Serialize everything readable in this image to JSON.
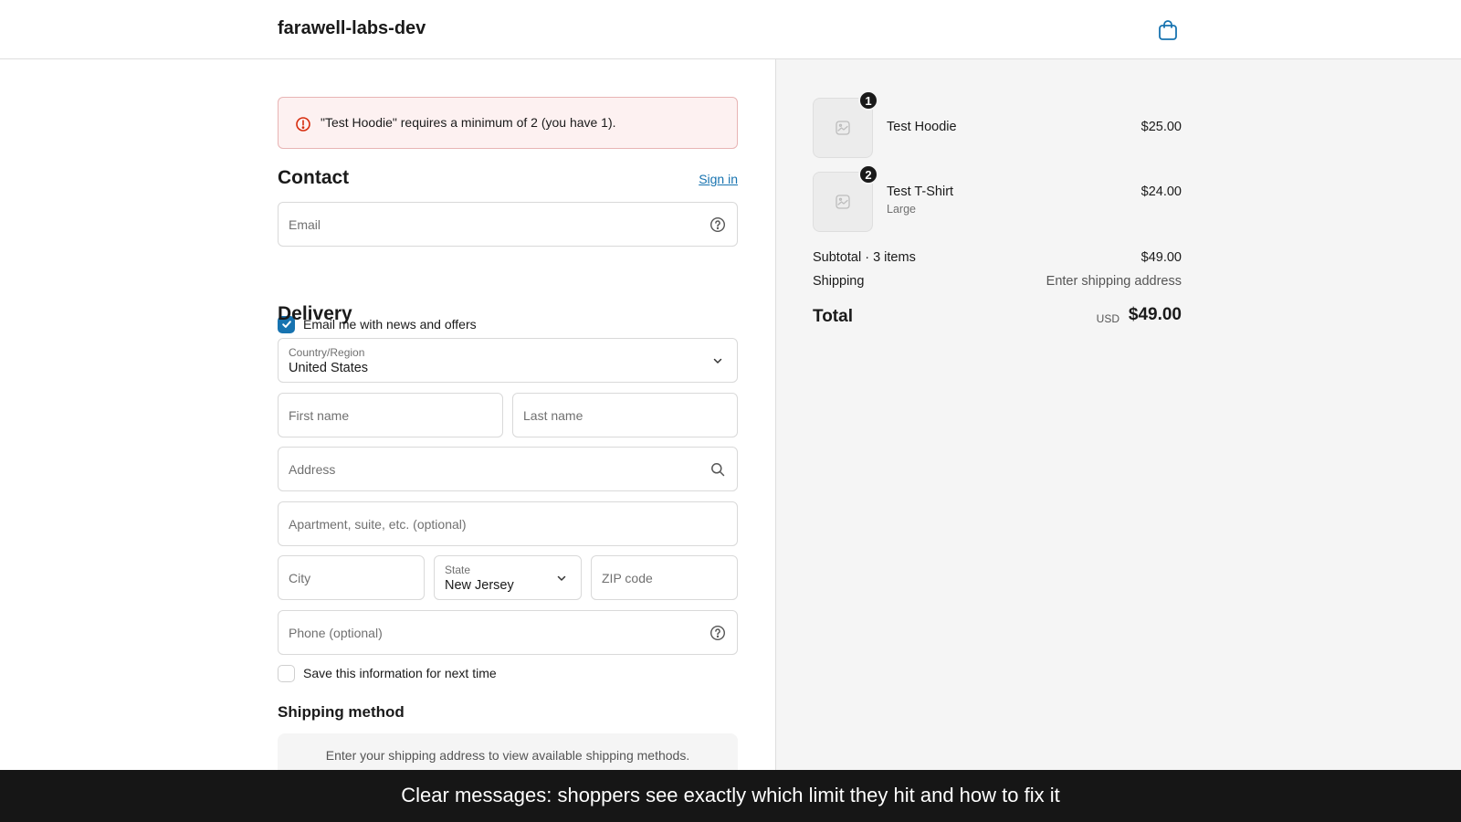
{
  "header": {
    "shop_name": "farawell-labs-dev",
    "cart_icon": "shopping-bag-icon"
  },
  "error": {
    "message": "\"Test Hoodie\" requires a minimum of 2 (you have 1).",
    "color": "#d72c0d"
  },
  "contact": {
    "title": "Contact",
    "sign_in_label": "Sign in",
    "email_placeholder": "Email",
    "news_checkbox_label": "Email me with news and offers",
    "news_checked": true
  },
  "delivery": {
    "title": "Delivery",
    "country_label": "Country/Region",
    "country_value": "United States",
    "first_name_placeholder": "First name",
    "last_name_placeholder": "Last name",
    "address_placeholder": "Address",
    "apartment_placeholder": "Apartment, suite, etc. (optional)",
    "city_placeholder": "City",
    "state_label": "State",
    "state_value": "New Jersey",
    "zip_placeholder": "ZIP code",
    "phone_placeholder": "Phone (optional)",
    "save_info_label": "Save this information for next time",
    "save_info_checked": false
  },
  "shipping_method": {
    "title": "Shipping method",
    "info": "Enter your shipping address to view available shipping methods."
  },
  "order_summary": {
    "items": [
      {
        "name": "Test Hoodie",
        "variant": "",
        "quantity": "1",
        "price": "$25.00"
      },
      {
        "name": "Test T-Shirt",
        "variant": "Large",
        "quantity": "2",
        "price": "$24.00"
      }
    ],
    "subtotal_label": "Subtotal · 3 items",
    "subtotal_value": "$49.00",
    "shipping_label": "Shipping",
    "shipping_value": "Enter shipping address",
    "total_label": "Total",
    "total_currency": "USD",
    "total_value": "$49.00"
  },
  "caption": "Clear messages: shoppers see exactly which limit they hit and how to fix it",
  "colors": {
    "accent": "#1773b0",
    "error_bg": "#fdf1f1",
    "summary_bg": "#f5f5f5",
    "caption_bg": "#161616"
  }
}
